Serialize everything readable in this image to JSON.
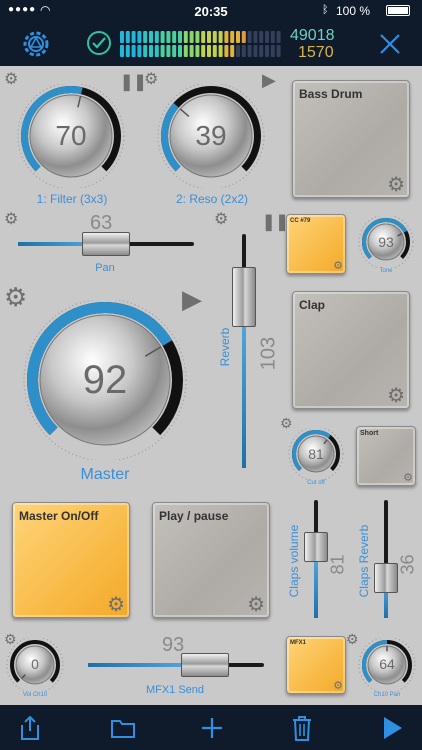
{
  "status": {
    "time": "20:35",
    "battery": "100 %"
  },
  "topbar": {
    "counter_top": "49018",
    "counter_bottom": "1570"
  },
  "knobs": {
    "filter": {
      "value": "70",
      "label": "1: Filter (3x3)",
      "level": 0.55
    },
    "reso": {
      "value": "39",
      "label": "2: Reso (2x2)",
      "level": 0.32
    },
    "master": {
      "value": "92",
      "label": "Master",
      "level": 0.72
    },
    "tone": {
      "value": "93",
      "label": "Tone",
      "level": 0.73
    },
    "cutoff": {
      "value": "81",
      "label": "Cut off",
      "level": 0.64
    },
    "vol_ch10": {
      "value": "0",
      "label": "Vol Ch10",
      "level": 0.0
    },
    "ch10_pan": {
      "value": "64",
      "label": "Ch10 Pan",
      "level": 0.5
    }
  },
  "sliders": {
    "pan": {
      "value": "63",
      "label": "Pan",
      "level": 0.5
    },
    "reverb": {
      "value": "103",
      "label": "Reverb",
      "level": 0.81
    },
    "claps_volume": {
      "value": "81",
      "label": "Claps volume",
      "level": 0.64
    },
    "claps_reverb": {
      "value": "36",
      "label": "Claps Reverb",
      "level": 0.28
    },
    "mfx1_send": {
      "value": "93",
      "label": "MFX1 Send",
      "level": 0.73
    }
  },
  "pads": {
    "bass_drum": "Bass Drum",
    "cc79": "CC #79",
    "clap": "Clap",
    "short": "Short",
    "master_onoff": "Master On/Off",
    "play_pause": "Play / pause",
    "mfx1": "MFX1"
  },
  "colors": {
    "accent": "#2f8fe0",
    "bar_bg": "#0f1a2b",
    "pad_orange": "#f7b63e",
    "check": "#2ec4a0"
  }
}
